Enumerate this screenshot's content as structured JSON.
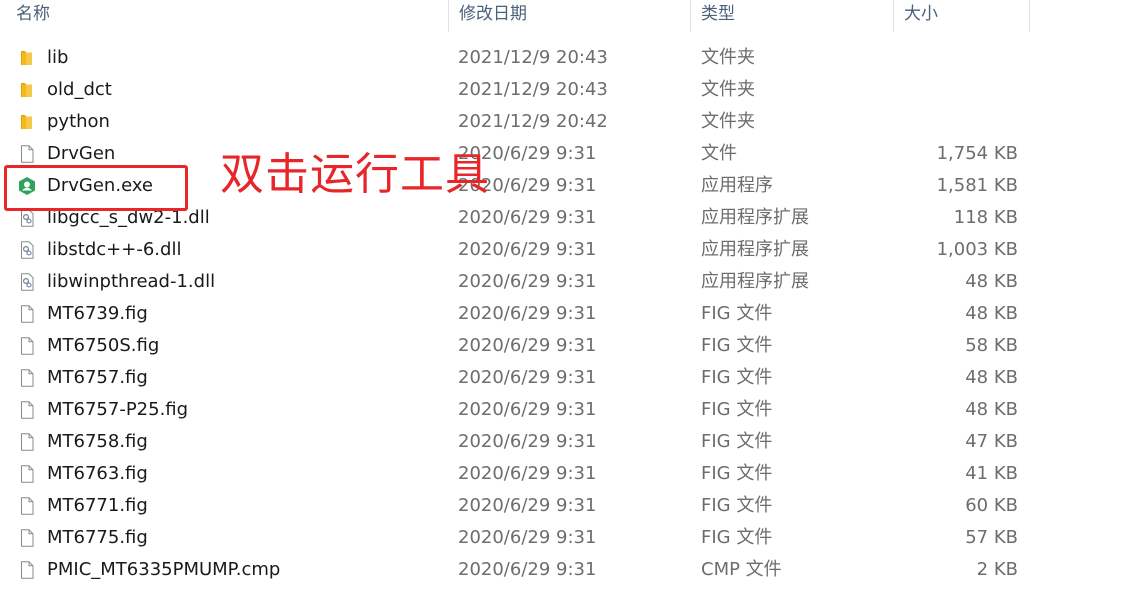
{
  "columns": {
    "name": "名称",
    "date": "修改日期",
    "type": "类型",
    "size": "大小"
  },
  "annotation": {
    "text": "双击运行工具",
    "color": "#e8262a"
  },
  "icons": {
    "folder": "folder-icon",
    "file": "file-icon",
    "exe": "app-icon",
    "dll": "dll-icon"
  },
  "files": [
    {
      "name": "lib",
      "date": "2021/12/9 20:43",
      "type": "文件夹",
      "size": "",
      "icon": "folder"
    },
    {
      "name": "old_dct",
      "date": "2021/12/9 20:43",
      "type": "文件夹",
      "size": "",
      "icon": "folder"
    },
    {
      "name": "python",
      "date": "2021/12/9 20:42",
      "type": "文件夹",
      "size": "",
      "icon": "folder"
    },
    {
      "name": "DrvGen",
      "date": "2020/6/29 9:31",
      "type": "文件",
      "size": "1,754 KB",
      "icon": "file"
    },
    {
      "name": "DrvGen.exe",
      "date": "2020/6/29 9:31",
      "type": "应用程序",
      "size": "1,581 KB",
      "icon": "exe"
    },
    {
      "name": "libgcc_s_dw2-1.dll",
      "date": "2020/6/29 9:31",
      "type": "应用程序扩展",
      "size": "118 KB",
      "icon": "dll"
    },
    {
      "name": "libstdc++-6.dll",
      "date": "2020/6/29 9:31",
      "type": "应用程序扩展",
      "size": "1,003 KB",
      "icon": "dll"
    },
    {
      "name": "libwinpthread-1.dll",
      "date": "2020/6/29 9:31",
      "type": "应用程序扩展",
      "size": "48 KB",
      "icon": "dll"
    },
    {
      "name": "MT6739.fig",
      "date": "2020/6/29 9:31",
      "type": "FIG 文件",
      "size": "48 KB",
      "icon": "file"
    },
    {
      "name": "MT6750S.fig",
      "date": "2020/6/29 9:31",
      "type": "FIG 文件",
      "size": "58 KB",
      "icon": "file"
    },
    {
      "name": "MT6757.fig",
      "date": "2020/6/29 9:31",
      "type": "FIG 文件",
      "size": "48 KB",
      "icon": "file"
    },
    {
      "name": "MT6757-P25.fig",
      "date": "2020/6/29 9:31",
      "type": "FIG 文件",
      "size": "48 KB",
      "icon": "file"
    },
    {
      "name": "MT6758.fig",
      "date": "2020/6/29 9:31",
      "type": "FIG 文件",
      "size": "47 KB",
      "icon": "file"
    },
    {
      "name": "MT6763.fig",
      "date": "2020/6/29 9:31",
      "type": "FIG 文件",
      "size": "41 KB",
      "icon": "file"
    },
    {
      "name": "MT6771.fig",
      "date": "2020/6/29 9:31",
      "type": "FIG 文件",
      "size": "60 KB",
      "icon": "file"
    },
    {
      "name": "MT6775.fig",
      "date": "2020/6/29 9:31",
      "type": "FIG 文件",
      "size": "57 KB",
      "icon": "file"
    },
    {
      "name": "PMIC_MT6335PMUMP.cmp",
      "date": "2020/6/29 9:31",
      "type": "CMP 文件",
      "size": "2 KB",
      "icon": "file"
    }
  ]
}
